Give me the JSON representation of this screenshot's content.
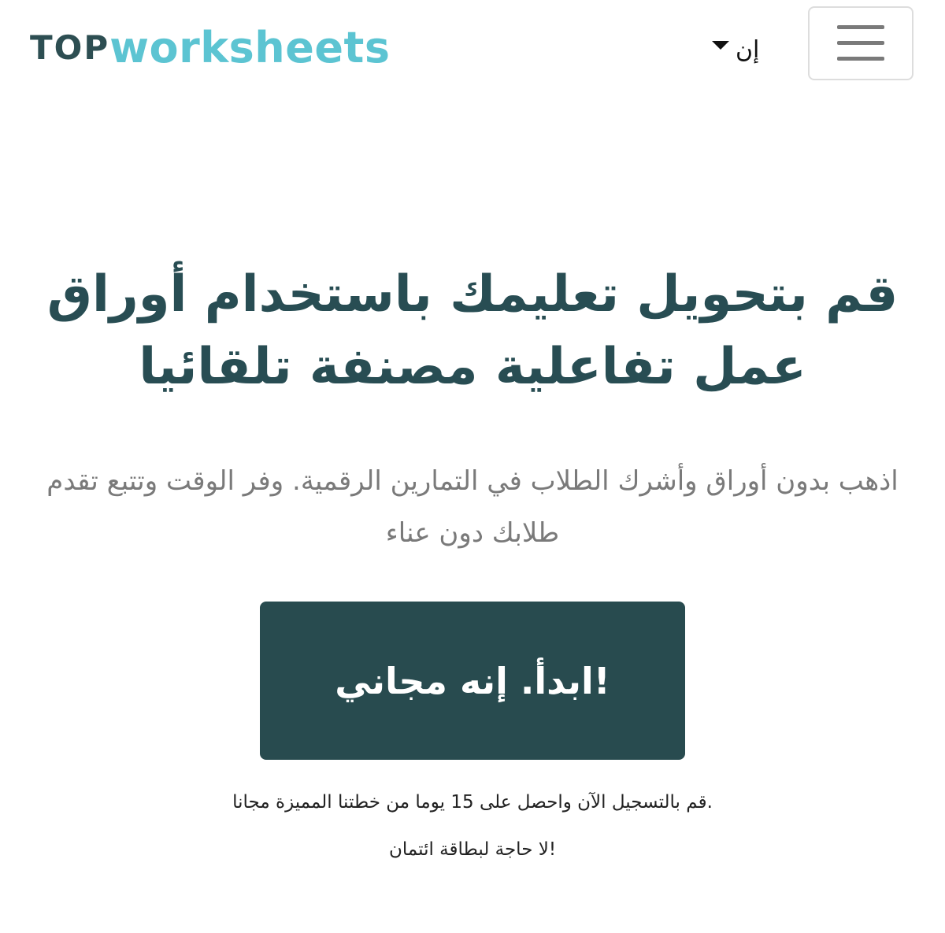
{
  "header": {
    "logo_top": "TOP",
    "logo_rest": "worksheets",
    "language_label": "إن",
    "colors": {
      "logo_dark": "#2d4e52",
      "logo_accent": "#5cc4d2"
    }
  },
  "hero": {
    "title": "قم بتحويل تعليمك باستخدام أوراق عمل تفاعلية مصنفة تلقائيا",
    "subtitle": "اذهب بدون أوراق وأشرك الطلاب في التمارين الرقمية. وفر الوقت وتتبع تقدم طلابك دون عناء",
    "cta_label": "!ابدأ. إنه مجاني",
    "note_line1": ".قم بالتسجيل الآن واحصل على 15 يوما من خطتنا المميزة مجانا",
    "note_line2": "!لا حاجة لبطاقة ائتمان",
    "colors": {
      "title": "#284d53",
      "cta_background": "#284b4f"
    }
  },
  "icons": {
    "language_caret": "caret-down-icon",
    "menu": "hamburger-icon"
  }
}
